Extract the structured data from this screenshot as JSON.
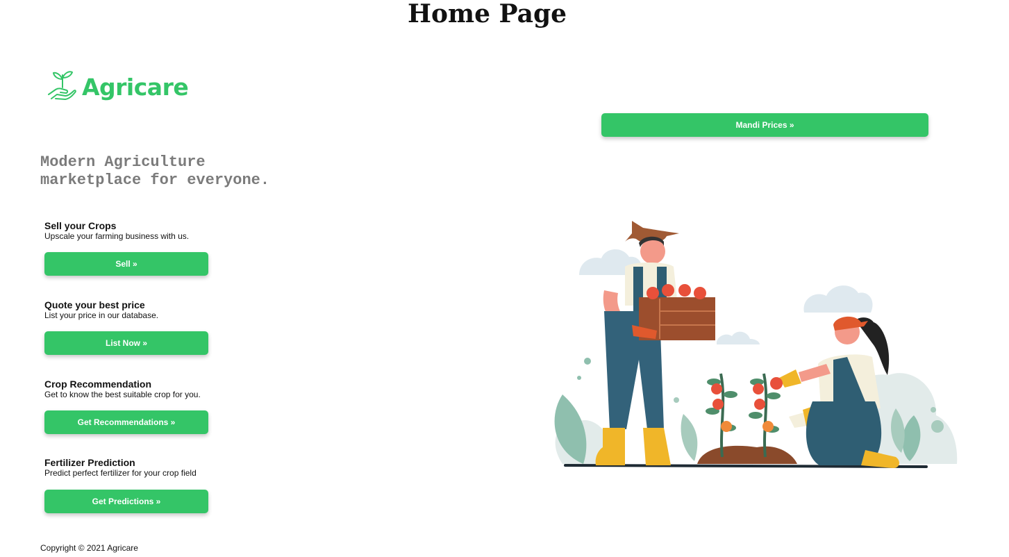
{
  "page": {
    "title": "Home Page"
  },
  "brand": {
    "name": "Agricare",
    "logo_icon": "sprout-in-hand-icon",
    "color": "#34c567"
  },
  "hero": {
    "tagline_line1": "Modern Agriculture",
    "tagline_line2": "marketplace for everyone."
  },
  "features": [
    {
      "title": "Sell your Crops",
      "description": "Upscale your farming business with us.",
      "button_label": "Sell »"
    },
    {
      "title": "Quote your best price",
      "description": "List your price in our database.",
      "button_label": "List Now »"
    },
    {
      "title": "Crop Recommendation",
      "description": "Get to know the best suitable crop for you.",
      "button_label": "Get Recommendations »"
    },
    {
      "title": "Fertilizer Prediction",
      "description": "Predict perfect fertilizer for your crop field",
      "button_label": "Get Predictions »"
    }
  ],
  "mandi": {
    "button_label": "Mandi Prices »"
  },
  "illustration": {
    "icon": "farmers-harvesting-tomatoes-illustration"
  },
  "footer": {
    "copyright": "Copyright © 2021 Agricare"
  },
  "colors": {
    "accent": "#34c567",
    "tagline_gray": "#7b7b7b"
  }
}
